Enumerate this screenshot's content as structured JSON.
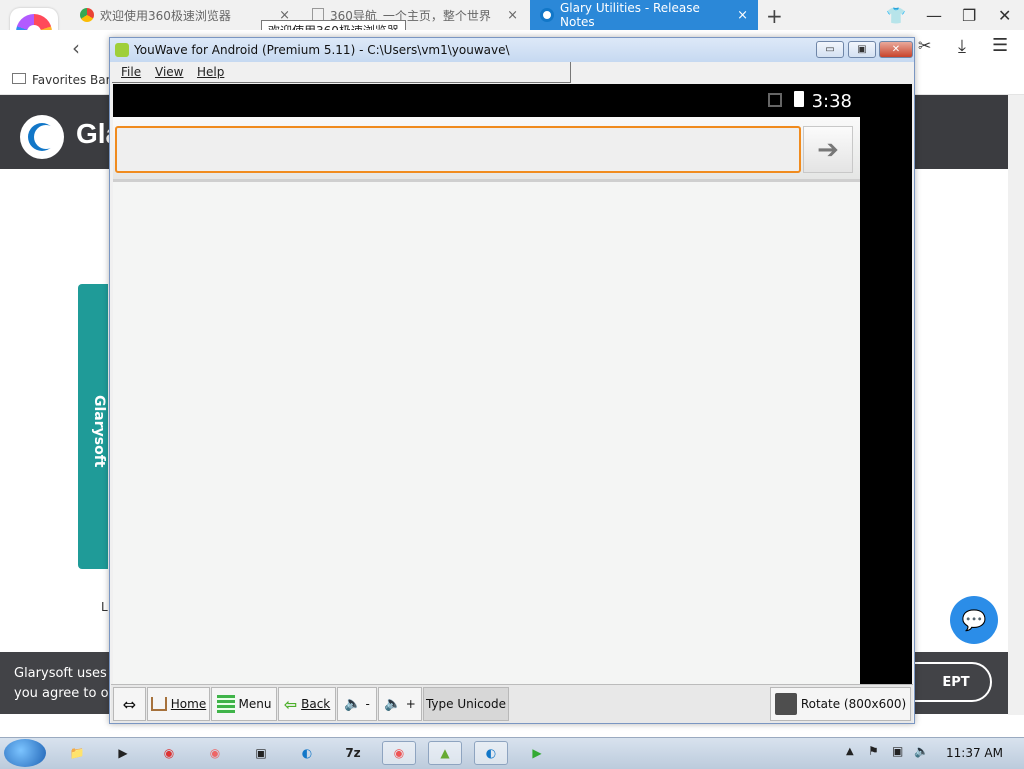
{
  "browser": {
    "tabs": [
      {
        "label": "欢迎使用360极速浏览器",
        "close": "×",
        "active": false
      },
      {
        "label": "360导航_一个主页，整个世界",
        "close": "×",
        "active": false
      },
      {
        "label": "Glary Utilities - Release Notes",
        "close": "×",
        "active": true
      }
    ],
    "new_tab": "+",
    "tooltip": "欢迎使用360极速浏览器",
    "favorites_bar": "Favorites Bar",
    "controls": {
      "minimize": "—",
      "restore": "❐",
      "close": "✕",
      "shirt": "👕",
      "menu": "☰",
      "download": "⤓",
      "cut": "✂"
    }
  },
  "page": {
    "logo_text": "Gla",
    "side_tab": "Glarysoft",
    "cookie_line1": "Glarysoft uses c",
    "cookie_line2": "you agree to ou",
    "accept_label": "EPT",
    "stray_letter": "L"
  },
  "youwave": {
    "title": "YouWave for Android (Premium 5.11) - C:\\Users\\vm1\\youwave\\",
    "menu": [
      "File",
      "View",
      "Help"
    ],
    "caption": {
      "minimize": "▭",
      "maximize": "▣",
      "close": "✕"
    },
    "android": {
      "clock": "3:38",
      "search_go": "➔"
    },
    "toolbar": {
      "resize": "⇔",
      "home": "Home",
      "menu": "Menu",
      "back": "Back",
      "vol_down": "-",
      "vol_up": "+",
      "type_unicode": "Type Unicode",
      "rotate": "Rotate (800x600)"
    }
  },
  "taskbar": {
    "clock": "11:37 AM",
    "apps": [
      "explorer",
      "media-player",
      "chrome",
      "firefox",
      "network",
      "glary",
      "7zip",
      "360-browser",
      "android",
      "glary-utilities",
      "camtasia"
    ],
    "app_glyphs": [
      "📁",
      "▶",
      "◉",
      "◉",
      "▣",
      "◐",
      "7z",
      "◉",
      "▲",
      "◐",
      "▶"
    ]
  },
  "colors": {
    "active_tab": "#2b88d8",
    "page_header": "#3b3c40",
    "side_tab": "#1f9b98",
    "search_border": "#f08b1e",
    "chat_button": "#2b8de8"
  }
}
